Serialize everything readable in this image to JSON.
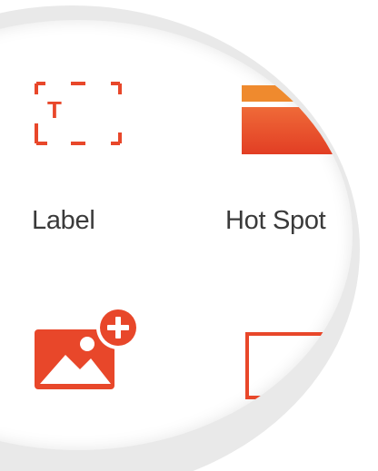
{
  "tools": [
    {
      "label": "Label",
      "icon": "label-text-icon"
    },
    {
      "label": "Hot Spot",
      "icon": "hot-spot-icon"
    },
    {
      "label": "",
      "icon": "add-image-icon"
    },
    {
      "label": "",
      "icon": "rectangle-icon"
    }
  ],
  "colors": {
    "accent": "#e8472a",
    "accent_light": "#ef7a3a",
    "ring": "#e9e9e9",
    "text": "#3a3a3a"
  }
}
